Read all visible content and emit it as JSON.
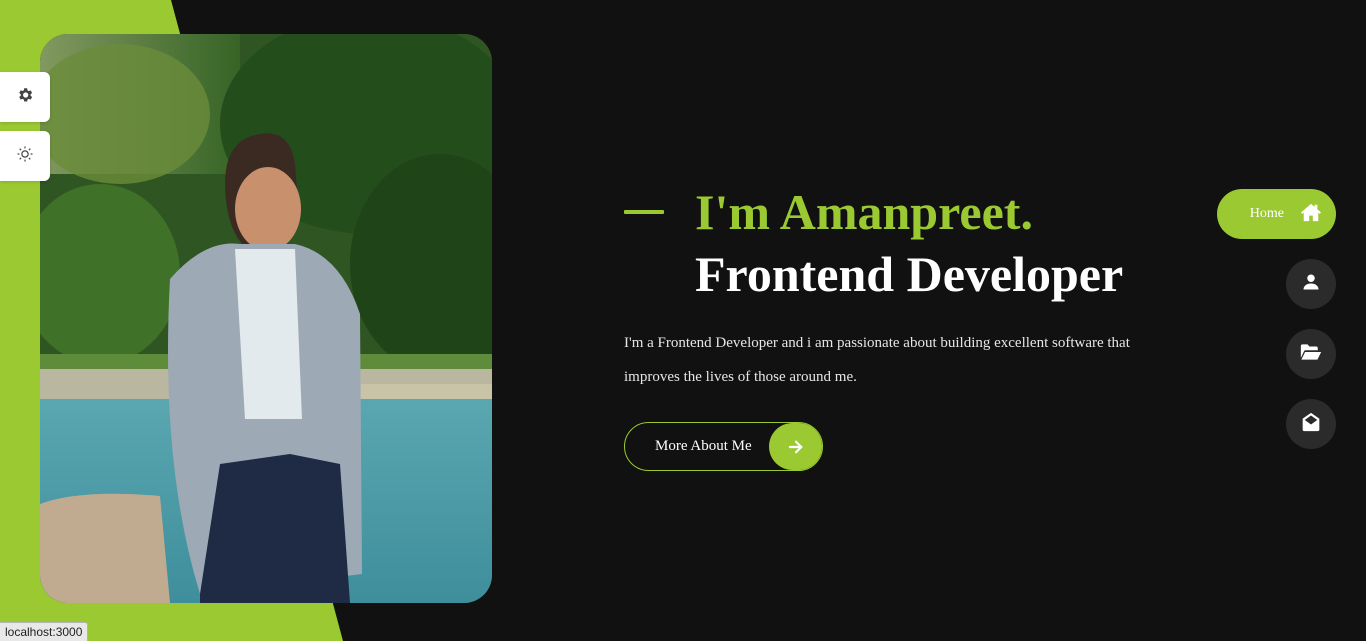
{
  "colors": {
    "accent": "#9bc932",
    "background": "#111111",
    "nav_inactive": "#2b2b2b",
    "text": "#ffffff"
  },
  "sidebar_tools": [
    {
      "icon": "gear-icon"
    },
    {
      "icon": "sun-icon"
    }
  ],
  "hero": {
    "greeting": "I'm Amanpreet.",
    "role": "Frontend Developer",
    "description_line1": "I'm a Frontend Developer and i am passionate about building excellent software that",
    "description_line2": "improves the lives of those around me.",
    "button_label": "More About Me",
    "button_icon": "arrow-right-icon"
  },
  "nav": {
    "home_label": "Home",
    "items": [
      {
        "icon": "home-icon",
        "active": true
      },
      {
        "icon": "user-icon",
        "active": false
      },
      {
        "icon": "folder-open-icon",
        "active": false
      },
      {
        "icon": "envelope-open-icon",
        "active": false
      }
    ]
  },
  "status_bar": {
    "url": "localhost:3000"
  }
}
